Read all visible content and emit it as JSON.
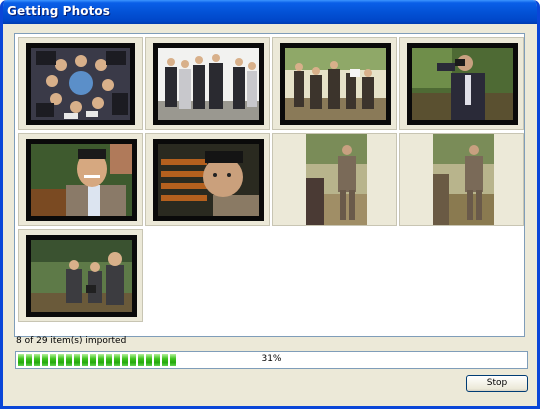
{
  "window": {
    "title": "Getting Photos"
  },
  "thumbnails": [
    {
      "subject": "group-photo-circle",
      "orientation": "landscape"
    },
    {
      "subject": "group-standing-outdoors",
      "orientation": "landscape"
    },
    {
      "subject": "group-camera-park",
      "orientation": "landscape"
    },
    {
      "subject": "man-photographing",
      "orientation": "landscape"
    },
    {
      "subject": "smiling-man-closeup",
      "orientation": "landscape"
    },
    {
      "subject": "man-face-closeup",
      "orientation": "landscape"
    },
    {
      "subject": "man-standing-portrait",
      "orientation": "portrait"
    },
    {
      "subject": "man-standing-portrait-2",
      "orientation": "portrait"
    },
    {
      "subject": "group-camera-trees",
      "orientation": "landscape"
    }
  ],
  "status": {
    "imported_text": "8 of 29 item(s) imported"
  },
  "progress": {
    "value": 0.31,
    "label": "31%"
  },
  "buttons": {
    "stop_label": "Stop"
  },
  "colors": {
    "titlebar": "#0352d6",
    "window_bg": "#ece9d8",
    "progress_fill": "#25a80c"
  }
}
